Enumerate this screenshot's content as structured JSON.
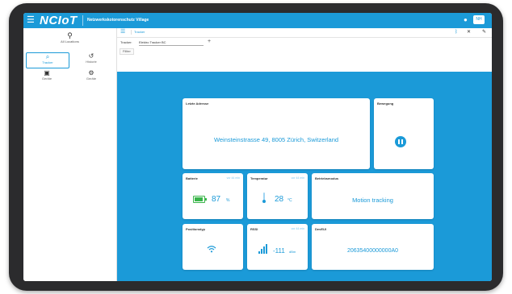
{
  "app": {
    "logo": "NCIoT",
    "company": "Netzwerkskotorenschutz Village",
    "user": "NH"
  },
  "icons": {
    "menu": "hamburger-icon",
    "user": "user-icon",
    "location": "map-pin-icon",
    "tracker": "search-icon",
    "history": "history-icon",
    "users": "users-icon",
    "settings": "settings-icon",
    "sidebar_toggle": "sidebar-toggle-icon",
    "bluetooth": "bluetooth-icon",
    "tool": "tool-icon",
    "pen": "pen-icon",
    "add": "plus-icon",
    "battery": "battery-icon",
    "thermometer": "thermometer-icon",
    "wifi": "wifi-icon",
    "signal": "signal-icon",
    "pause": "pause-icon"
  },
  "sidebar": {
    "location_label": "All Locations",
    "items": [
      {
        "label": "Tracker"
      },
      {
        "label": "Historie"
      },
      {
        "label": "Geräte"
      },
      {
        "label": "Geräte"
      }
    ]
  },
  "toolbar": {
    "crumb": "Tracker"
  },
  "filter": {
    "tracker_label": "Tracker:",
    "tracker_value": "Elektro Tracker BC",
    "tab": "Fillter"
  },
  "cards": {
    "address": {
      "title": "Letzte Adresse",
      "value": "Weinsteinstrasse 49, 8005 Zürich, Switzerland"
    },
    "movement": {
      "title": "Bewegung"
    },
    "battery": {
      "title": "Batterie",
      "time": "vor 44 min",
      "value": "87",
      "unit": "%",
      "level": 0.87
    },
    "temperature": {
      "title": "Temperatur",
      "time": "vor 44 min",
      "value": "28",
      "unit": "°C"
    },
    "mode": {
      "title": "Betriebsmodus",
      "value": "Motion tracking"
    },
    "position": {
      "title": "Positionstyp"
    },
    "rssi": {
      "title": "RSSI",
      "time": "vor 44 min",
      "value": "-111",
      "unit": "dBm"
    },
    "devui": {
      "title": "DevEUI",
      "value": "20635400000000A0"
    }
  },
  "colors": {
    "brand": "#1b9ad8",
    "battery": "#39b54a"
  }
}
